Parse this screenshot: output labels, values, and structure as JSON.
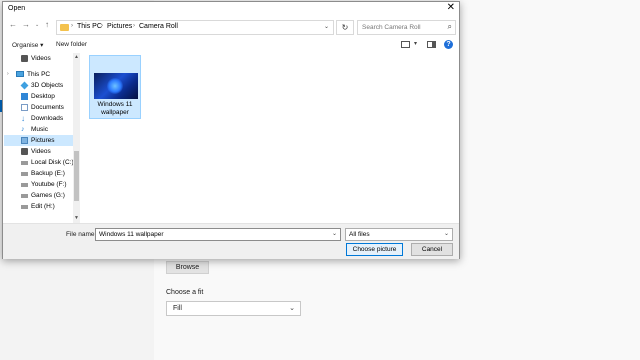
{
  "background_app": {
    "browse_label": "Browse",
    "fit_label": "Choose a fit",
    "fit_value": "Fill"
  },
  "dialog": {
    "title": "Open",
    "close_glyph": "✕",
    "breadcrumbs": [
      "This PC",
      "Pictures",
      "Camera Roll"
    ],
    "search_placeholder": "Search Camera Roll",
    "toolbar": {
      "organise_label": "Organise ▾",
      "new_folder_label": "New folder"
    },
    "sidebar": {
      "items": [
        {
          "label": "Videos",
          "icon": "videos-icon"
        },
        {
          "label": "This PC",
          "icon": "pc-icon"
        },
        {
          "label": "3D Objects",
          "icon": "3d-objects-icon"
        },
        {
          "label": "Desktop",
          "icon": "desktop-icon"
        },
        {
          "label": "Documents",
          "icon": "documents-icon"
        },
        {
          "label": "Downloads",
          "icon": "downloads-icon"
        },
        {
          "label": "Music",
          "icon": "music-icon"
        },
        {
          "label": "Pictures",
          "icon": "pictures-icon"
        },
        {
          "label": "Videos",
          "icon": "videos-icon"
        },
        {
          "label": "Local Disk (C:)",
          "icon": "drive-icon"
        },
        {
          "label": "Backup (E:)",
          "icon": "drive-icon"
        },
        {
          "label": "Youtube (F:)",
          "icon": "drive-icon"
        },
        {
          "label": "Games (G:)",
          "icon": "drive-icon"
        },
        {
          "label": "Edit (H:)",
          "icon": "drive-icon"
        }
      ],
      "selected_index": 7
    },
    "files": [
      {
        "name": "Windows 11 wallpaper"
      }
    ],
    "footer": {
      "file_name_label": "File name:",
      "file_name_value": "Windows 11 wallpaper",
      "filter_value": "All files",
      "choose_label": "Choose picture",
      "cancel_label": "Cancel"
    }
  },
  "colors": {
    "accent": "#0078d7",
    "selection": "#cce8ff",
    "folder": "#f4c24d"
  }
}
